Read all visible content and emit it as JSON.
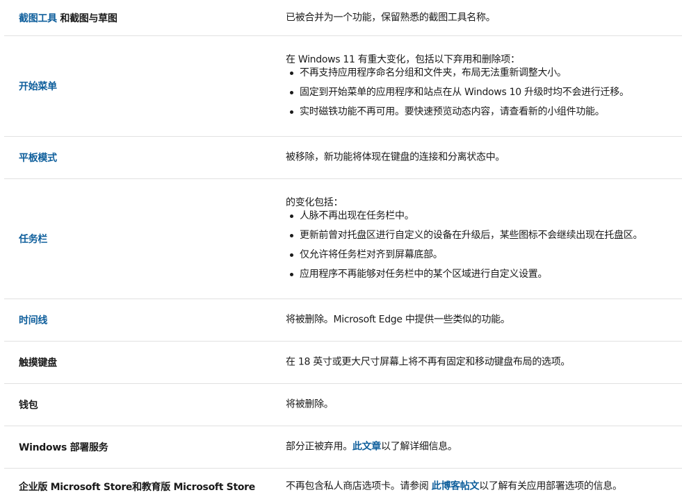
{
  "rows": [
    {
      "feature_link": "截图工具",
      "feature_text": " 和截图与草图",
      "description": "已被合并为一个功能，保留熟悉的截图工具名称。"
    },
    {
      "feature_link": "开始菜单",
      "intro": "在 Windows 11 有重大变化，包括以下弃用和删除项：",
      "bullets": [
        "不再支持应用程序命名分组和文件夹，布局无法重新调整大小。",
        "固定到开始菜单的应用程序和站点在从 Windows 10 升级时均不会进行迁移。",
        "实时磁铁功能不再可用。要快速预览动态内容，请查看新的小组件功能。"
      ]
    },
    {
      "feature_link": "平板模式",
      "description": "被移除，新功能将体现在键盘的连接和分离状态中。"
    },
    {
      "feature_link": "任务栏",
      "intro": "的变化包括：",
      "bullets": [
        "人脉不再出现在任务栏中。",
        "更新前曾对托盘区进行自定义的设备在升级后，某些图标不会继续出现在托盘区。",
        "仅允许将任务栏对齐到屏幕底部。",
        "应用程序不再能够对任务栏中的某个区域进行自定义设置。"
      ]
    },
    {
      "feature_link": "时间线",
      "description": "将被删除。Microsoft Edge 中提供一些类似的功能。"
    },
    {
      "feature_text": "触摸键盘",
      "description": "在 18 英寸或更大尺寸屏幕上将不再有固定和移动键盘布局的选项。"
    },
    {
      "feature_text": "钱包",
      "description": "将被删除。"
    },
    {
      "feature_text": "Windows 部署服务",
      "desc_before": "部分正被弃用。",
      "desc_link": "此文章",
      "desc_after": "以了解详细信息。"
    },
    {
      "feature_text": "企业版 Microsoft Store和教育版 Microsoft Store",
      "desc_before": "不再包含私人商店选项卡。请参阅 ",
      "desc_link": "此博客帖文",
      "desc_after": "以了解有关应用部署选项的信息。"
    }
  ]
}
